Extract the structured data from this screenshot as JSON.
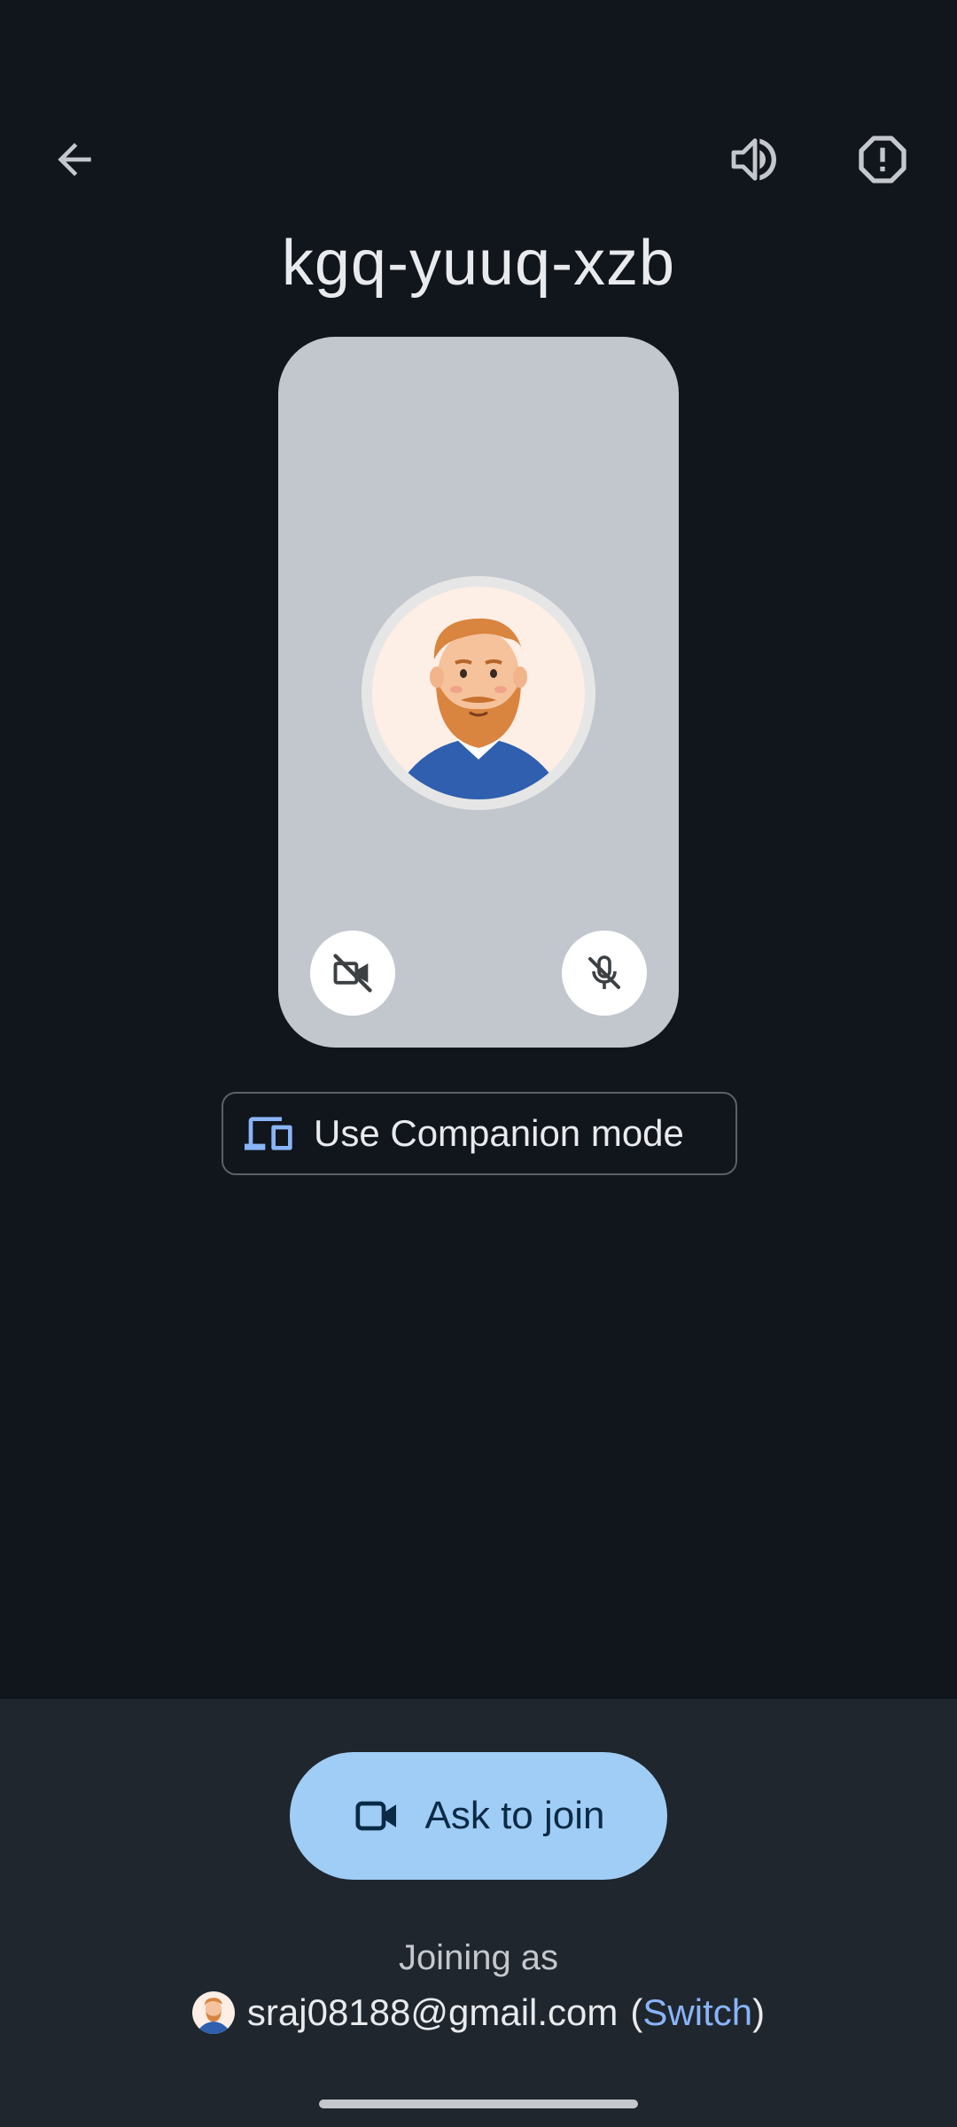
{
  "header": {
    "back_icon": "arrow-back-icon",
    "speaker_icon": "volume-up-icon",
    "report_icon": "report-octagon-icon"
  },
  "meeting": {
    "code": "kgq-yuuq-xzb"
  },
  "preview": {
    "camera_icon": "videocam-off-icon",
    "mic_icon": "mic-off-icon"
  },
  "companion": {
    "label": "Use Companion mode",
    "icon": "devices-icon"
  },
  "join": {
    "label": "Ask to join",
    "icon": "videocam-outline-icon"
  },
  "account": {
    "joining_label": "Joining as",
    "email": "sraj08188@gmail.com",
    "open_paren": "(",
    "switch_label": "Switch",
    "close_paren": ")"
  },
  "colors": {
    "background": "#11151c",
    "bottom_panel": "#1f262e",
    "join_button": "#a0cdf5",
    "link": "#8ab4f8",
    "preview_card": "#c2c6cd"
  }
}
